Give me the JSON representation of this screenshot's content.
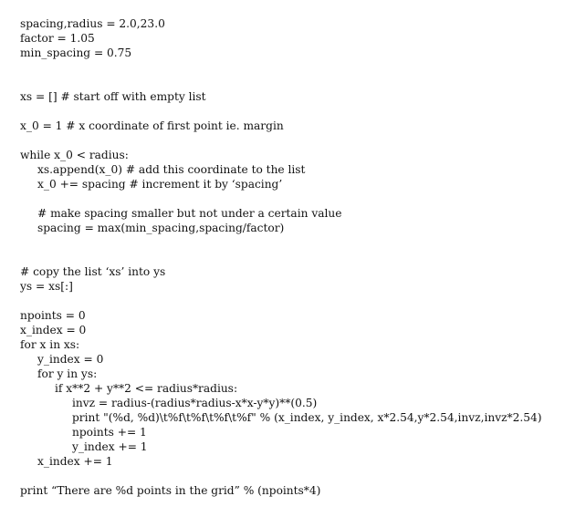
{
  "code": {
    "l01": "spacing,radius = 2.0,23.0",
    "l02": "factor = 1.05",
    "l03": "min_spacing = 0.75",
    "l04": "xs = [] # start off with empty list",
    "l05": "x_0 = 1 # x coordinate of first point ie. margin",
    "l06": "while x_0 < radius:",
    "l07": "xs.append(x_0) # add this coordinate to the list",
    "l08": "x_0 += spacing # increment it by ‘spacing’",
    "l09": "# make spacing smaller but not under a certain value",
    "l10": "spacing = max(min_spacing,spacing/factor)",
    "l11": "# copy the list ‘xs’ into ys",
    "l12": "ys = xs[:]",
    "l13": "npoints = 0",
    "l14": "x_index = 0",
    "l15": "for x in xs:",
    "l16": "y_index = 0",
    "l17": "for y in ys:",
    "l18": "if x**2 + y**2 <= radius*radius:",
    "l19": "invz = radius-(radius*radius-x*x-y*y)**(0.5)",
    "l20": "print \"(%d, %d)\\t%f\\t%f\\t%f\\t%f\" % (x_index, y_index, x*2.54,y*2.54,invz,invz*2.54)",
    "l21": "npoints += 1",
    "l22": "y_index += 1",
    "l23": "x_index += 1",
    "l24": "print “There are %d points in the grid” % (npoints*4)"
  }
}
